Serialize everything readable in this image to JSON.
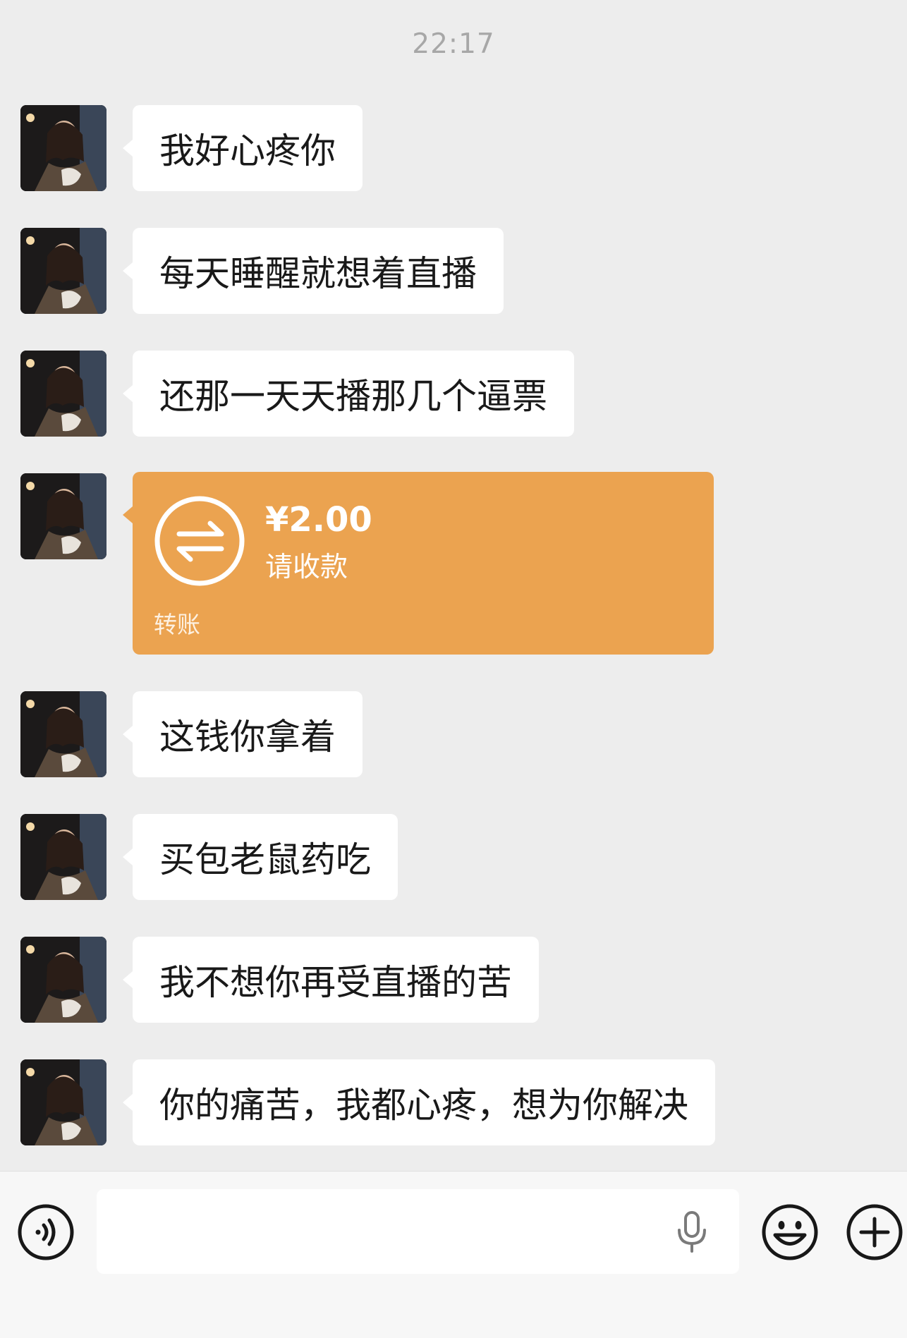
{
  "chat": {
    "timestamp": "22:17",
    "messages": [
      {
        "type": "text",
        "text": "我好心疼你"
      },
      {
        "type": "text",
        "text": "每天睡醒就想着直播"
      },
      {
        "type": "text",
        "text": "还那一天天播那几个逼票"
      },
      {
        "type": "transfer",
        "amount": "¥2.00",
        "status": "请收款",
        "label": "转账"
      },
      {
        "type": "text",
        "text": "这钱你拿着"
      },
      {
        "type": "text",
        "text": "买包老鼠药吃"
      },
      {
        "type": "text",
        "text": "我不想你再受直播的苦"
      },
      {
        "type": "text",
        "text": "你的痛苦，我都心疼，想为你解决"
      }
    ]
  },
  "toolbar": {
    "input_value": "",
    "icons": [
      "voice-icon",
      "microphone-icon",
      "emoji-icon",
      "plus-icon"
    ]
  },
  "colors": {
    "background": "#ededed",
    "bubble": "#ffffff",
    "transfer": "#eba350",
    "timestamp": "#a7a7a7"
  }
}
